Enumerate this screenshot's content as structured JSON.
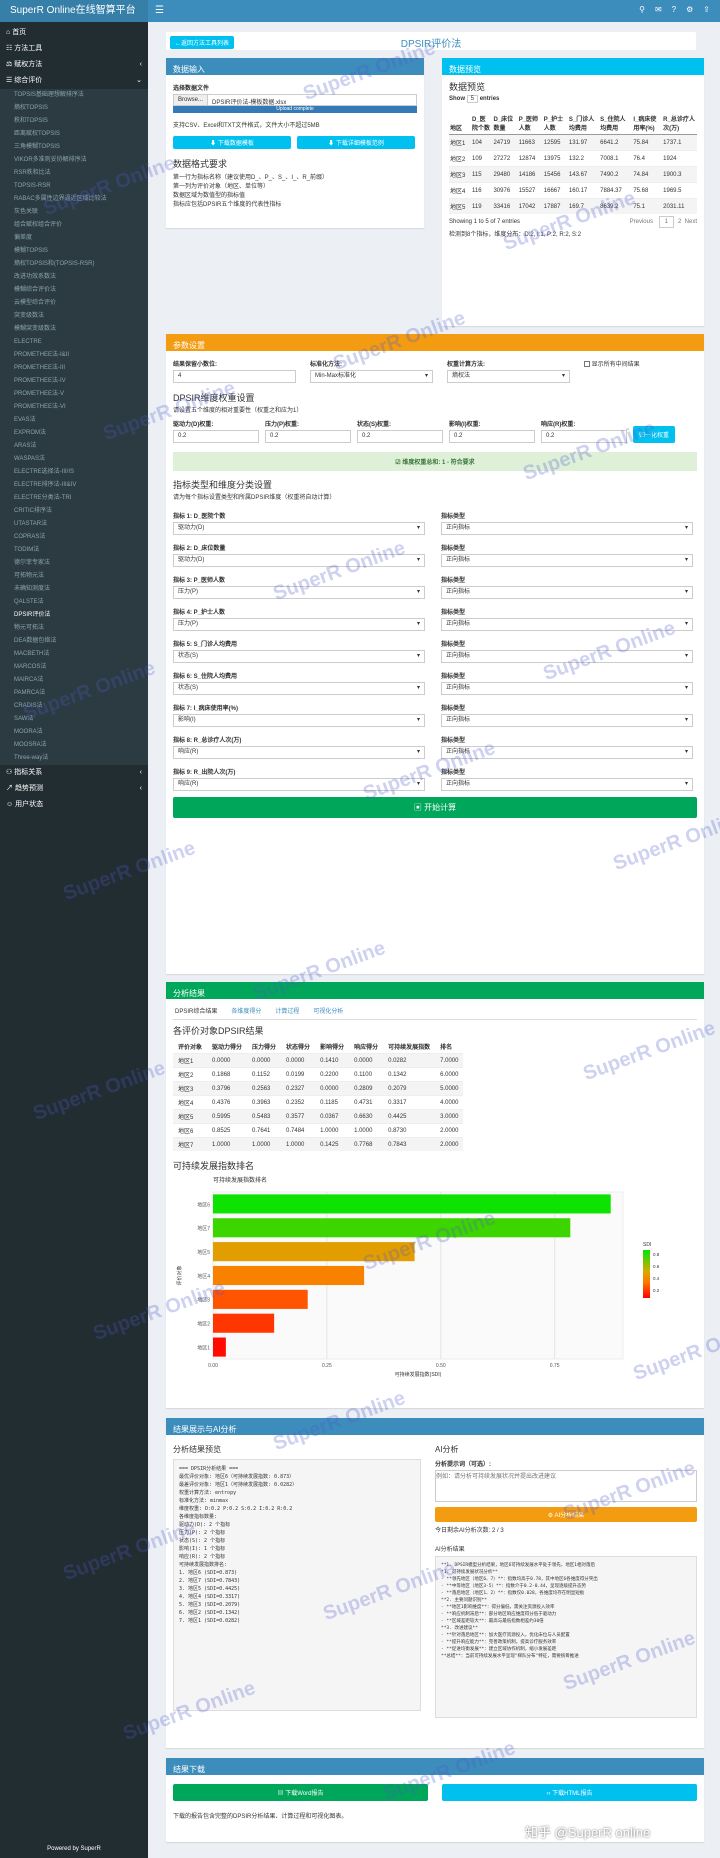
{
  "app": {
    "title": "SuperR Online在线智算平台",
    "footer": "Powered by SuperR",
    "user": "用户状态"
  },
  "sidebar": {
    "home": "首页",
    "tools": "方法工具",
    "queue": "赋权方法",
    "eval": "综合评价",
    "relation": "指标关系",
    "forecast": "趋势预测",
    "user": "用户状态",
    "items": [
      "TOPSIS基础理想解排序法",
      "熵权TOPSIS",
      "秩和TOPSIS",
      "距离赋权TOPSIS",
      "三角模糊TOPSIS",
      "VIKOR多准则妥协解排序法",
      "RSR秩和比法",
      "TOPSIS-RSR",
      "RABAC多属性边界逼近区域比较法",
      "灰色关联",
      "组合赋权组合评价",
      "偏差度",
      "模糊TOPSIS",
      "熵权TOPSIS和(TOPSIS-RSR)",
      "改进功效系数法",
      "模糊综合评价法",
      "云模型综合评价",
      "突变级数法",
      "模糊突变级数法",
      "ELECTRE",
      "PROMETHEE法-I&II",
      "PROMETHEE法-III",
      "PROMETHEE法-IV",
      "PROMETHEE法-V",
      "PROMETHEE法-VI",
      "EVAS法",
      "EXPROM法",
      "ARAS法",
      "WASPAS法",
      "ELECTRE选择法-III/IS",
      "ELECTRE排序法-III&IV",
      "ELECTRE分类法-TRI",
      "CRITIC排序法",
      "UTASTAR法",
      "COPRAS法",
      "TODIM法",
      "德尔菲专家法",
      "可拓物元法",
      "未确知测度法",
      "QALSTE法",
      "DPSIR评价法",
      "物元可拓法",
      "DEA数据包络法",
      "MACBETH法",
      "MARCOS法",
      "MAIRCA法",
      "PAMRCA法",
      "CRADIS法",
      "SAW法",
      "MOORA法",
      "MOOSRA法",
      "Three-way法"
    ],
    "active_index": 40
  },
  "header": {
    "back_label": "←返回方法工具列表",
    "title": "DPSIR评价法"
  },
  "input": {
    "title": "数据输入",
    "file_label": "选择数据文件",
    "browse": "Browse...",
    "file_name": "DPSIR评价法-模板数据.xlsx",
    "upload_status": "Upload complete",
    "support": "支持CSV、Excel和TXT文件格式，文件大小不超过5MB",
    "btn_template": "下载数据模板",
    "btn_example": "下载详细模板范例",
    "format_title": "数据格式要求",
    "format_lines": [
      "第一行为指标名称（建议使用D_、P_、S_、I_、R_前缀）",
      "第一列为评价对象（地区、单位等）",
      "数据区域为数值型的指标值",
      "指标应包括DPSIR五个维度的代表性指标"
    ]
  },
  "preview": {
    "title": "数据预览",
    "subtitle": "数据预览",
    "show": "Show",
    "entries_n": "5",
    "entries": "entries",
    "columns": [
      "地区",
      "D_医院个数",
      "D_床位数量",
      "P_医师人数",
      "P_护士人数",
      "S_门诊人均费用",
      "S_住院人均费用",
      "I_病床使用率(%)",
      "R_总诊疗人次(万)"
    ],
    "rows": [
      [
        "地区1",
        "104",
        "24719",
        "11663",
        "12595",
        "131.97",
        "6641.2",
        "75.84",
        "1737.1"
      ],
      [
        "地区2",
        "109",
        "27272",
        "12874",
        "13975",
        "132.2",
        "7008.1",
        "76.4",
        "1924"
      ],
      [
        "地区3",
        "115",
        "29480",
        "14186",
        "15456",
        "143.67",
        "7490.2",
        "74.84",
        "1900.3"
      ],
      [
        "地区4",
        "116",
        "30976",
        "15527",
        "16667",
        "160.17",
        "7884.37",
        "75.68",
        "1969.5"
      ],
      [
        "地区5",
        "119",
        "33416",
        "17042",
        "17887",
        "169.7",
        "8639.2",
        "75.1",
        "2031.11"
      ]
    ],
    "info": "Showing 1 to 5 of 7 entries",
    "prev": "Previous",
    "page1": "1",
    "page2": "2",
    "next": "Next",
    "detected": "检测到8个指标，维度分布：D:2, I:1, P:2, R:2, S:2"
  },
  "params": {
    "title": "参数设置",
    "decimal_label": "结果保留小数位:",
    "decimal_val": "4",
    "std_label": "标准化方法:",
    "std_val": "Min-Max标准化",
    "weight_label": "权重计算方法:",
    "weight_val": "熵权法",
    "show_mid": "显示所有中间结果",
    "dim_title": "DPSIR维度权重设置",
    "dim_note": "请设置五个维度的相对重要性（权重之和应为1）",
    "dims": [
      {
        "label": "驱动力(D)权重:",
        "val": "0.2"
      },
      {
        "label": "压力(P)权重:",
        "val": "0.2"
      },
      {
        "label": "状态(S)权重:",
        "val": "0.2"
      },
      {
        "label": "影响(I)权重:",
        "val": "0.2"
      },
      {
        "label": "响应(R)权重:",
        "val": "0.2"
      }
    ],
    "normalize": "归一化权重",
    "sum_msg": "维度权重总和: 1 - 符合要求",
    "cls_title": "指标类型和维度分类设置",
    "cls_note": "请为每个指标设置类型和所属DPSIR维度（权重将自动计算）",
    "indicators": [
      {
        "label": "指标 1: D_医院个数",
        "dim": "驱动力(D)",
        "type": "正向指标"
      },
      {
        "label": "指标 2: D_床位数量",
        "dim": "驱动力(D)",
        "type": "正向指标"
      },
      {
        "label": "指标 3: P_医师人数",
        "dim": "压力(P)",
        "type": "正向指标"
      },
      {
        "label": "指标 4: P_护士人数",
        "dim": "压力(P)",
        "type": "正向指标"
      },
      {
        "label": "指标 5: S_门诊人均费用",
        "dim": "状态(S)",
        "type": "正向指标"
      },
      {
        "label": "指标 6: S_住院人均费用",
        "dim": "状态(S)",
        "type": "正向指标"
      },
      {
        "label": "指标 7: I_病床使用率(%)",
        "dim": "影响(I)",
        "type": "正向指标"
      },
      {
        "label": "指标 8: R_总诊疗人次(万)",
        "dim": "响应(R)",
        "type": "正向指标"
      },
      {
        "label": "指标 9: R_出院人次(万)",
        "dim": "响应(R)",
        "type": "正向指标"
      }
    ],
    "type_label": "指标类型",
    "start": "开始计算"
  },
  "results": {
    "title": "分析结果",
    "tabs": [
      "DPSIR综合结果",
      "各维度得分",
      "计算过程",
      "可视化分析"
    ],
    "sub": "各评价对象DPSIR结果",
    "columns": [
      "评价对象",
      "驱动力得分",
      "压力得分",
      "状态得分",
      "影响得分",
      "响应得分",
      "可持续发展指数",
      "排名"
    ],
    "rows": [
      [
        "地区1",
        "0.0000",
        "0.0000",
        "0.0000",
        "0.1410",
        "0.0000",
        "0.0282",
        "7.0000"
      ],
      [
        "地区2",
        "0.1868",
        "0.1152",
        "0.0199",
        "0.2200",
        "0.1100",
        "0.1342",
        "6.0000"
      ],
      [
        "地区3",
        "0.3796",
        "0.2563",
        "0.2327",
        "0.0000",
        "0.2809",
        "0.2079",
        "5.0000"
      ],
      [
        "地区4",
        "0.4376",
        "0.3963",
        "0.2352",
        "0.1185",
        "0.4731",
        "0.3317",
        "4.0000"
      ],
      [
        "地区5",
        "0.5995",
        "0.5483",
        "0.3577",
        "0.0367",
        "0.6630",
        "0.4425",
        "3.0000"
      ],
      [
        "地区6",
        "0.8525",
        "0.7641",
        "0.7484",
        "1.0000",
        "1.0000",
        "0.8730",
        "2.0000"
      ],
      [
        "地区7",
        "1.0000",
        "1.0000",
        "1.0000",
        "0.1425",
        "0.7768",
        "0.7843",
        "2.0000"
      ]
    ],
    "chart_heading": "可持续发展指数排名"
  },
  "chart_data": {
    "type": "bar",
    "orientation": "horizontal",
    "title": "可持续发展指数排名",
    "xlabel": "可持续发展指数(SDI)",
    "ylabel": "评价对象",
    "categories": [
      "地区6",
      "地区7",
      "地区5",
      "地区4",
      "地区3",
      "地区2",
      "地区1"
    ],
    "values": [
      0.873,
      0.7843,
      0.4425,
      0.3317,
      0.2079,
      0.1342,
      0.0282
    ],
    "xlim": [
      0,
      0.9
    ],
    "xticks": [
      "0.00",
      "0.25",
      "0.50",
      "0.75"
    ],
    "legend_title": "SDI",
    "legend_ticks": [
      "0.8",
      "0.6",
      "0.4",
      "0.2"
    ]
  },
  "ai": {
    "title": "结果展示与AI分析",
    "preview_title": "分析结果预览",
    "preview_lines": [
      "=== DPSIR分析结果 ===",
      "最优评价对象: 地区6（可持续发展指数: 0.873）",
      "最差评价对象: 地区1（可持续发展指数: 0.0282）",
      "权重计算方法: entropy",
      "标准化方法: minmax",
      "维度权重: D:0.2 P:0.2 S:0.2 I:0.2 R:0.2",
      "",
      "各维度指标数量:",
      "驱动力(D): 2 个指标",
      "压力(P): 2 个指标",
      "状态(S): 2 个指标",
      "影响(I): 1 个指标",
      "响应(R): 2 个指标",
      "",
      "可持续发展指数排名:",
      "1. 地区6 (SDI=0.873)",
      "2. 地区7 (SDI=0.7843)",
      "3. 地区5 (SDI=0.4425)",
      "4. 地区4 (SDI=0.3317)",
      "5. 地区3 (SDI=0.2079)",
      "6. 地区2 (SDI=0.1342)",
      "7. 地区1 (SDI=0.0282)"
    ],
    "ai_title": "AI分析",
    "prompt_label": "分析提示词（可选）:",
    "prompt_placeholder": "例如：请分析可持续发展状况并提出改进建议",
    "ai_btn": "AI分析结果",
    "remaining": "今日剩余AI分析次数: 2 / 3",
    "ai_result_label": "AI分析结果",
    "ai_lines": [
      "**1. DPSIR模型分析结果，地区6可持续发展水平处于领先，地区1相对落后",
      "*1. 可持续发展状况分析**",
      "- **领先地区（地区6、7）**：指数均高于0.78，其中地区6各维度得分突出",
      "- **中等地区（地区3-5）**：指数介于0.2-0.44，呈现逐级提升态势",
      "- **落后地区（地区1、2）**：指数仅0.028，各维度均存在明显短板",
      "",
      "**2. 主要问题识别**",
      "- **地区1影响维度**：得分偏低，需关注资源投入效率",
      "- **响应机制滞后**：部分地区响应维度得分低于驱动力",
      "- **区域差距较大**：最高与最低指数相差约30倍",
      "",
      "**3. 改进建议**",
      "- **针对落后地区**：加大医疗资源投入，优化床位与人员配置",
      "- **提升响应能力**：完善政策机制，提高诊疗服务效率",
      "- **促进均衡发展**：建立区域协作机制，缩小发展差距",
      "",
      "**总结**：当前可持续发展水平呈现\"梯队分布\"特征，需要统筹推进"
    ]
  },
  "download": {
    "title": "结果下载",
    "btn_word": "下载Word报告",
    "btn_html": "下载HTML报告",
    "note": "下载的报告包含完整的DPSIR分析结果、计算过程和可视化图表。"
  },
  "watermark": "SuperR Online",
  "credit": "知乎 @SuperR online"
}
